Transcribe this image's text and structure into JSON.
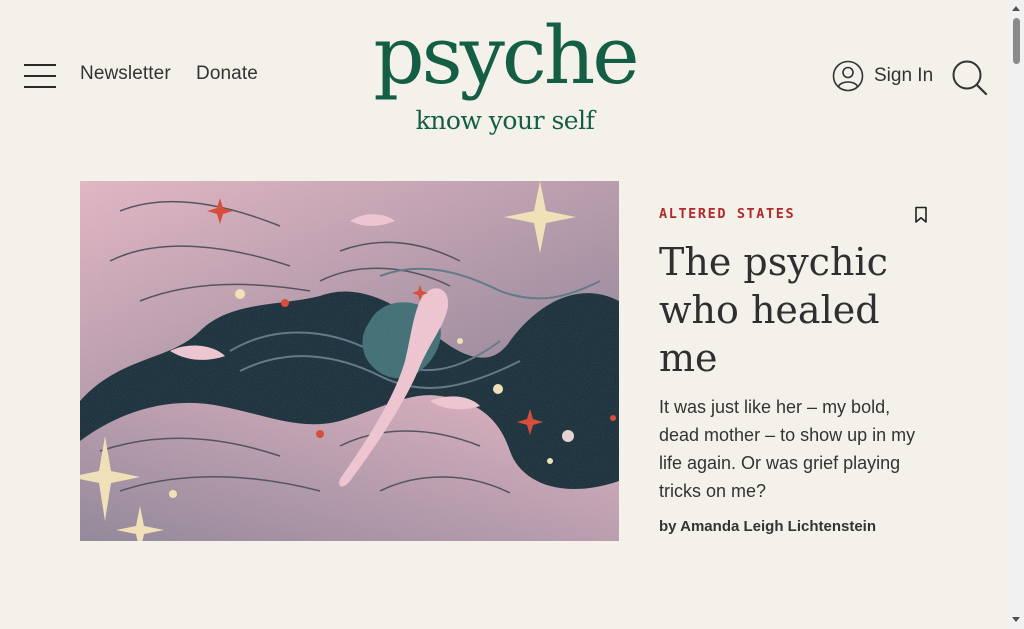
{
  "header": {
    "nav_links": [
      "Newsletter",
      "Donate"
    ],
    "logo_word": "psyche",
    "logo_tagline": "know your self",
    "sign_in_label": "Sign In"
  },
  "article": {
    "category": "ALTERED STATES",
    "title": "The psychic who healed me",
    "summary": "It was just like her – my bold, dead mother – to show up in my life again. Or was grief playing tricks on me?",
    "byline_prefix": "by",
    "author": "Amanda Leigh Lichtenstein"
  },
  "colors": {
    "background": "#f4f1eb",
    "brand_green": "#135e45",
    "category_red": "#b02a2a",
    "illustration_pink": "#e2b4c3",
    "illustration_navy": "#132a35"
  },
  "icons": {
    "menu": "hamburger-menu-icon",
    "account": "user-circle-icon",
    "search": "search-icon",
    "bookmark": "bookmark-icon"
  }
}
